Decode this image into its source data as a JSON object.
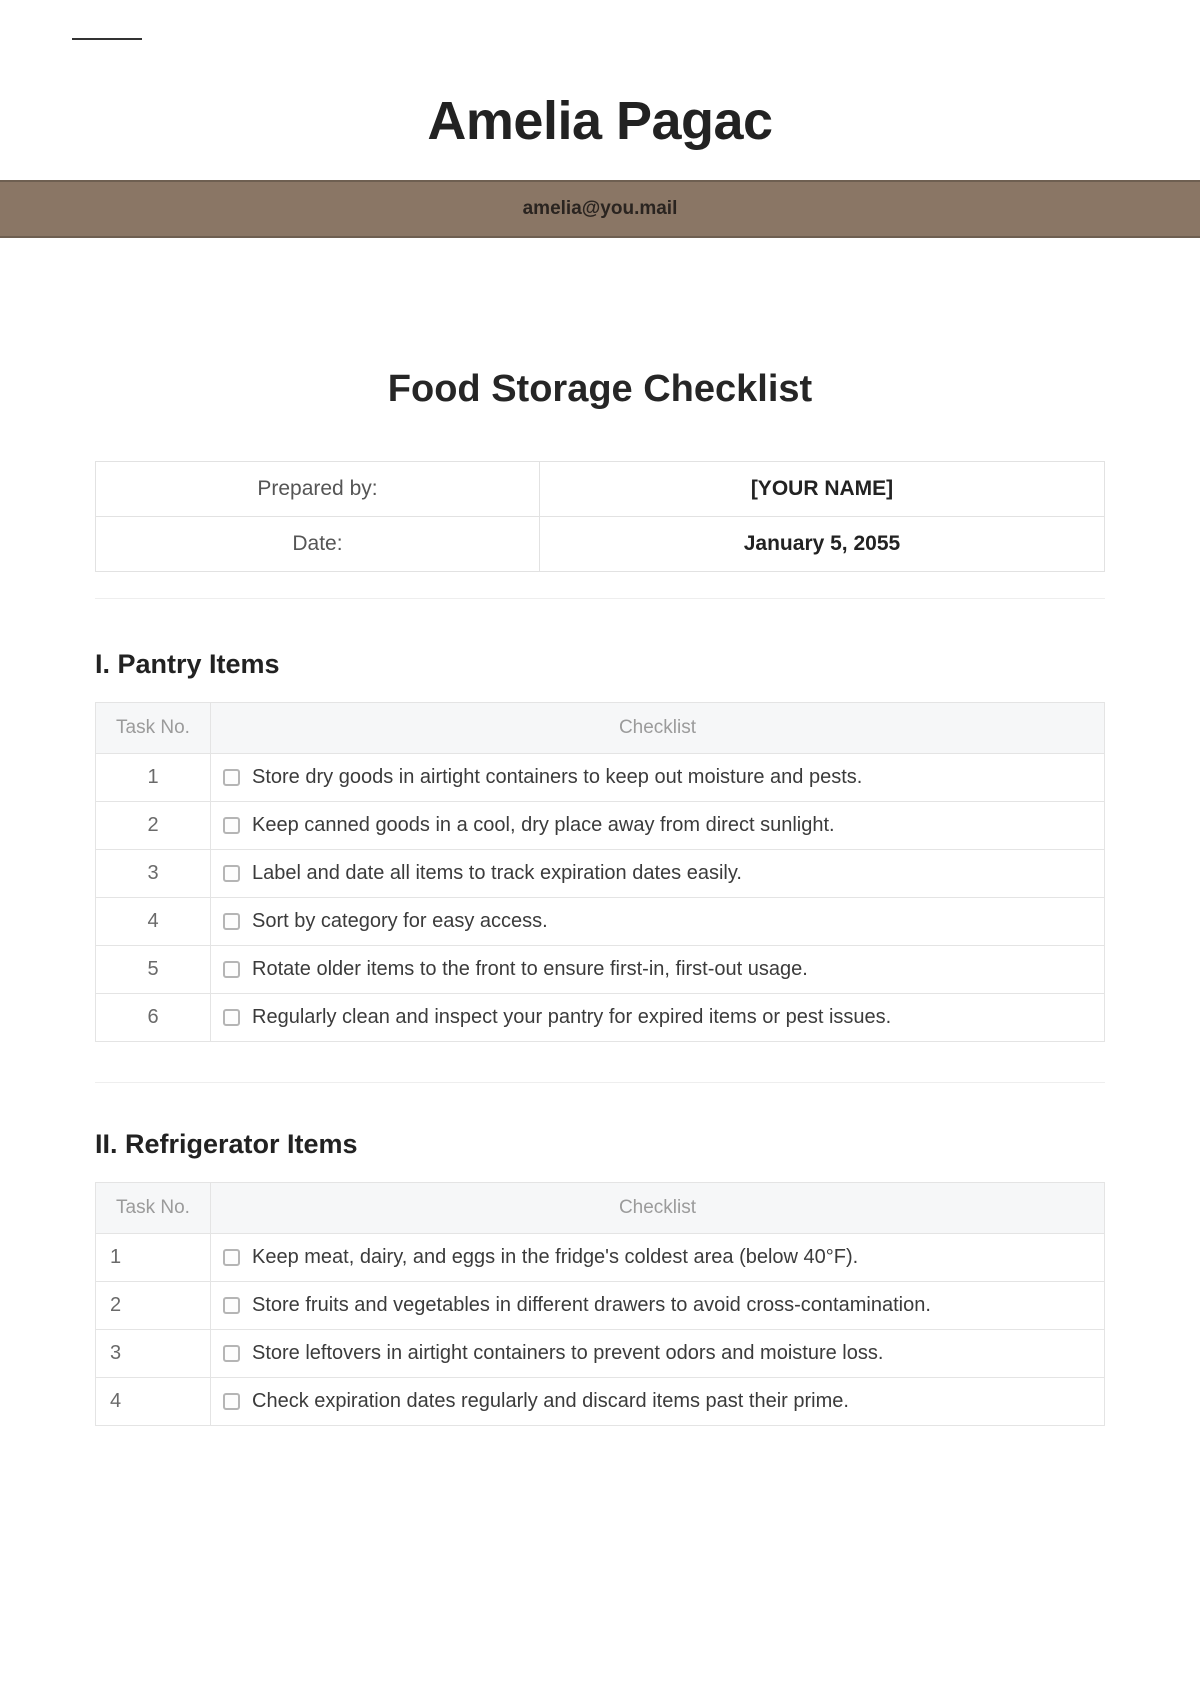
{
  "header": {
    "name": "Amelia Pagac",
    "email": "amelia@you.mail"
  },
  "doc_title": "Food Storage Checklist",
  "info": {
    "prepared_by_label": "Prepared by:",
    "prepared_by_value": "[YOUR NAME]",
    "date_label": "Date:",
    "date_value": "January 5, 2055"
  },
  "tables": {
    "task_no_header": "Task No.",
    "checklist_header": "Checklist"
  },
  "section1": {
    "title": "I. Pantry Items",
    "rows": [
      {
        "n": "1",
        "text": "Store dry goods in airtight containers to keep out moisture and pests."
      },
      {
        "n": "2",
        "text": "Keep canned goods in a cool, dry place away from direct sunlight."
      },
      {
        "n": "3",
        "text": "Label and date all items to track expiration dates easily."
      },
      {
        "n": "4",
        "text": "Sort by category for easy access."
      },
      {
        "n": "5",
        "text": "Rotate older items to the front to ensure first-in, first-out usage."
      },
      {
        "n": "6",
        "text": "Regularly clean and inspect your pantry for expired items or pest issues."
      }
    ]
  },
  "section2": {
    "title": "II. Refrigerator Items",
    "rows": [
      {
        "n": "1",
        "text": "Keep meat, dairy, and eggs in the fridge's coldest area (below 40°F)."
      },
      {
        "n": "2",
        "text": "Store fruits and vegetables in different drawers to avoid cross-contamination."
      },
      {
        "n": "3",
        "text": "Store leftovers in airtight containers to prevent odors and moisture loss."
      },
      {
        "n": "4",
        "text": "Check expiration dates regularly and discard items past their prime."
      }
    ]
  }
}
